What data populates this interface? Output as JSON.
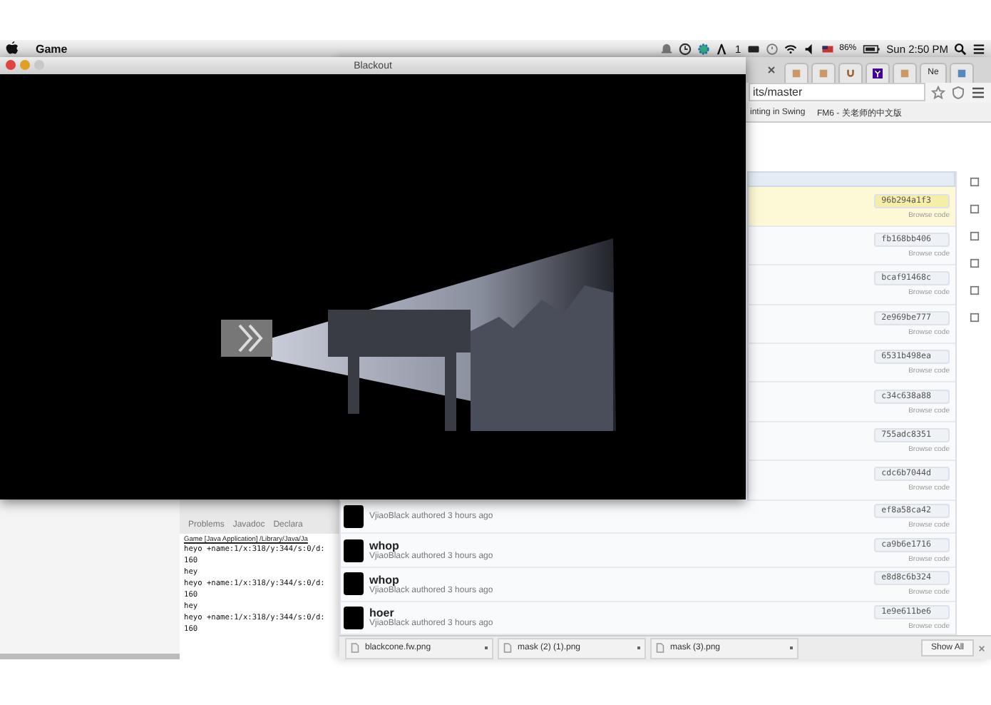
{
  "menu_bar": {
    "app_name": "Game",
    "notification_count": "1",
    "battery": "86%",
    "clock": "Sun 2:50 PM"
  },
  "game_window": {
    "title": "Blackout"
  },
  "browser": {
    "tab_label": "Ne",
    "address": "its/master",
    "bookmarks": [
      "inting in Swing",
      "FM6 - 关老师的中文版"
    ],
    "commits": [
      {
        "hash": "96b294a1f3",
        "browse": "Browse code",
        "selected": true
      },
      {
        "hash": "fb168bb406",
        "browse": "Browse code",
        "selected": false
      },
      {
        "hash": "bcaf91468c",
        "browse": "Browse code",
        "selected": false
      },
      {
        "hash": "2e969be777",
        "browse": "Browse code",
        "selected": false
      },
      {
        "hash": "6531b498ea",
        "browse": "Browse code",
        "selected": false
      },
      {
        "hash": "c34c638a88",
        "browse": "Browse code",
        "selected": false
      },
      {
        "hash": "755adc8351",
        "browse": "Browse code",
        "selected": false
      },
      {
        "hash": "cdc6b7044d",
        "browse": "Browse code",
        "selected": false
      },
      {
        "author": "VjiaoBlack authored 3 hours ago",
        "hash": "ef8a58ca42",
        "browse": "Browse code",
        "selected": false
      },
      {
        "title": "whop",
        "author": "VjiaoBlack authored 3 hours ago",
        "hash": "ca9b6e1716",
        "browse": "Browse code",
        "selected": false
      },
      {
        "title": "whop",
        "author": "VjiaoBlack authored 3 hours ago",
        "hash": "e8d8c6b324",
        "browse": "Browse code",
        "selected": false
      },
      {
        "title": "hoer",
        "author": "VjiaoBlack authored 3 hours ago",
        "hash": "1e9e611be6",
        "browse": "Browse code",
        "selected": false
      }
    ],
    "downloads": [
      "blackcone.fw.png",
      "mask (2) (1).png",
      "mask (3).png"
    ],
    "show_all": "Show All"
  },
  "eclipse": {
    "tabs": [
      {
        "label": "Problems",
        "selected": false
      },
      {
        "label": "Javadoc",
        "selected": false
      },
      {
        "label": "Declara",
        "selected": false
      }
    ],
    "console_header": "Game [Java Application] /Library/Java/Ja",
    "console_lines": [
      "heyo +name:1/x:318/y:344/s:0/d:",
      "160",
      "hey",
      "heyo +name:1/x:318/y:344/s:0/d:",
      "160",
      "hey",
      "heyo +name:1/x:318/y:344/s:0/d:",
      "160"
    ]
  }
}
